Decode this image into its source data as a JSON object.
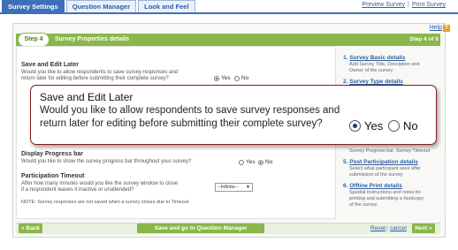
{
  "tabs": [
    {
      "label": "Survey Settings",
      "active": true
    },
    {
      "label": "Question Manager",
      "active": false
    },
    {
      "label": "Look and Feel",
      "active": false
    }
  ],
  "top_links": {
    "preview": "Preview Survey",
    "separator": "|",
    "print": "Print Survey"
  },
  "help": {
    "label": "Help",
    "icon": "?"
  },
  "step": {
    "badge": "Step 4",
    "title": "Survey Properties details",
    "of": "Step 4 of 6"
  },
  "settings": {
    "save_edit": {
      "title": "Save and Edit Later",
      "desc_line1": "Would you like to allow respondents to save survey responses and",
      "desc_line2": "return later for editing before submitting their complete survey?",
      "yes": "Yes",
      "no": "No",
      "selected": "Yes"
    },
    "progress": {
      "title": "Display Progress bar",
      "desc": "Would you like to show the survey progress bar throughout your survey?",
      "yes": "Yes",
      "no": "No",
      "selected": "No"
    },
    "timeout": {
      "title": "Participation Timeout",
      "desc_line1": "After how many minutes would you like the survey window to close",
      "desc_line2": "if a respondent leaves it inactive or unattended?",
      "value": "--Infinite--"
    },
    "note": "NOTE: Survey responses are not saved when a survey closes due to Timeout."
  },
  "sidebar": {
    "items": [
      {
        "num": "1.",
        "label": "Survey Basic details",
        "desc_line1": "Add Survey Title, Desciption and",
        "desc_line2": "Owner of the survey"
      },
      {
        "num": "2.",
        "label": "Survey Type details"
      },
      {
        "num": "",
        "label": "",
        "desc_line1": "Survey Progress bar, Survey Timeout",
        "desc_line2": ""
      },
      {
        "num": "5.",
        "label": "Post Participation details",
        "desc_line1": "Select what participant sees after",
        "desc_line2": "submission of the survey"
      },
      {
        "num": "6.",
        "label": "Offline Print details",
        "desc_line1": "Spedial instructions and notes for",
        "desc_line2": "printing and submitting a hardcopy",
        "desc_line3": "of the survey"
      }
    ]
  },
  "bottom": {
    "back": "« Back",
    "save_go": "Save and go to Question Manager",
    "reset": "Reset",
    "sep": "|",
    "next": "Next »"
  },
  "callout": {
    "title": "Save and Edit Later",
    "desc_line1": "Would you like to allow respondents to save survey responses and",
    "desc_line2": "return later for editing before submitting their complete survey?",
    "yes": "Yes",
    "no": "No",
    "selected": "Yes"
  }
}
